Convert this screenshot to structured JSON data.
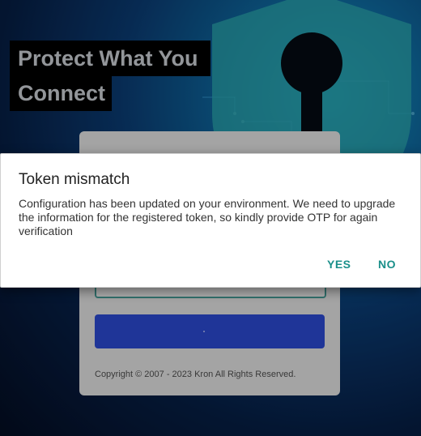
{
  "hero": {
    "line1": "Protect What You",
    "line2": "Connect"
  },
  "login_card": {
    "otp_input_value": "",
    "submit_label": "",
    "copyright": "Copyright © 2007 - 2023 Kron All Rights Reserved."
  },
  "dialog": {
    "title": "Token mismatch",
    "message": "Configuration has been updated on your environment. We need to upgrade the information for the registered token, so kindly provide OTP for again verification",
    "yes_label": "YES",
    "no_label": "NO"
  },
  "colors": {
    "accent": "#1a8f8a",
    "primary_button": "#2f4fe0",
    "background_dark": "#05122a"
  },
  "icons": {
    "background_art": "shield-keyhole-icon"
  }
}
